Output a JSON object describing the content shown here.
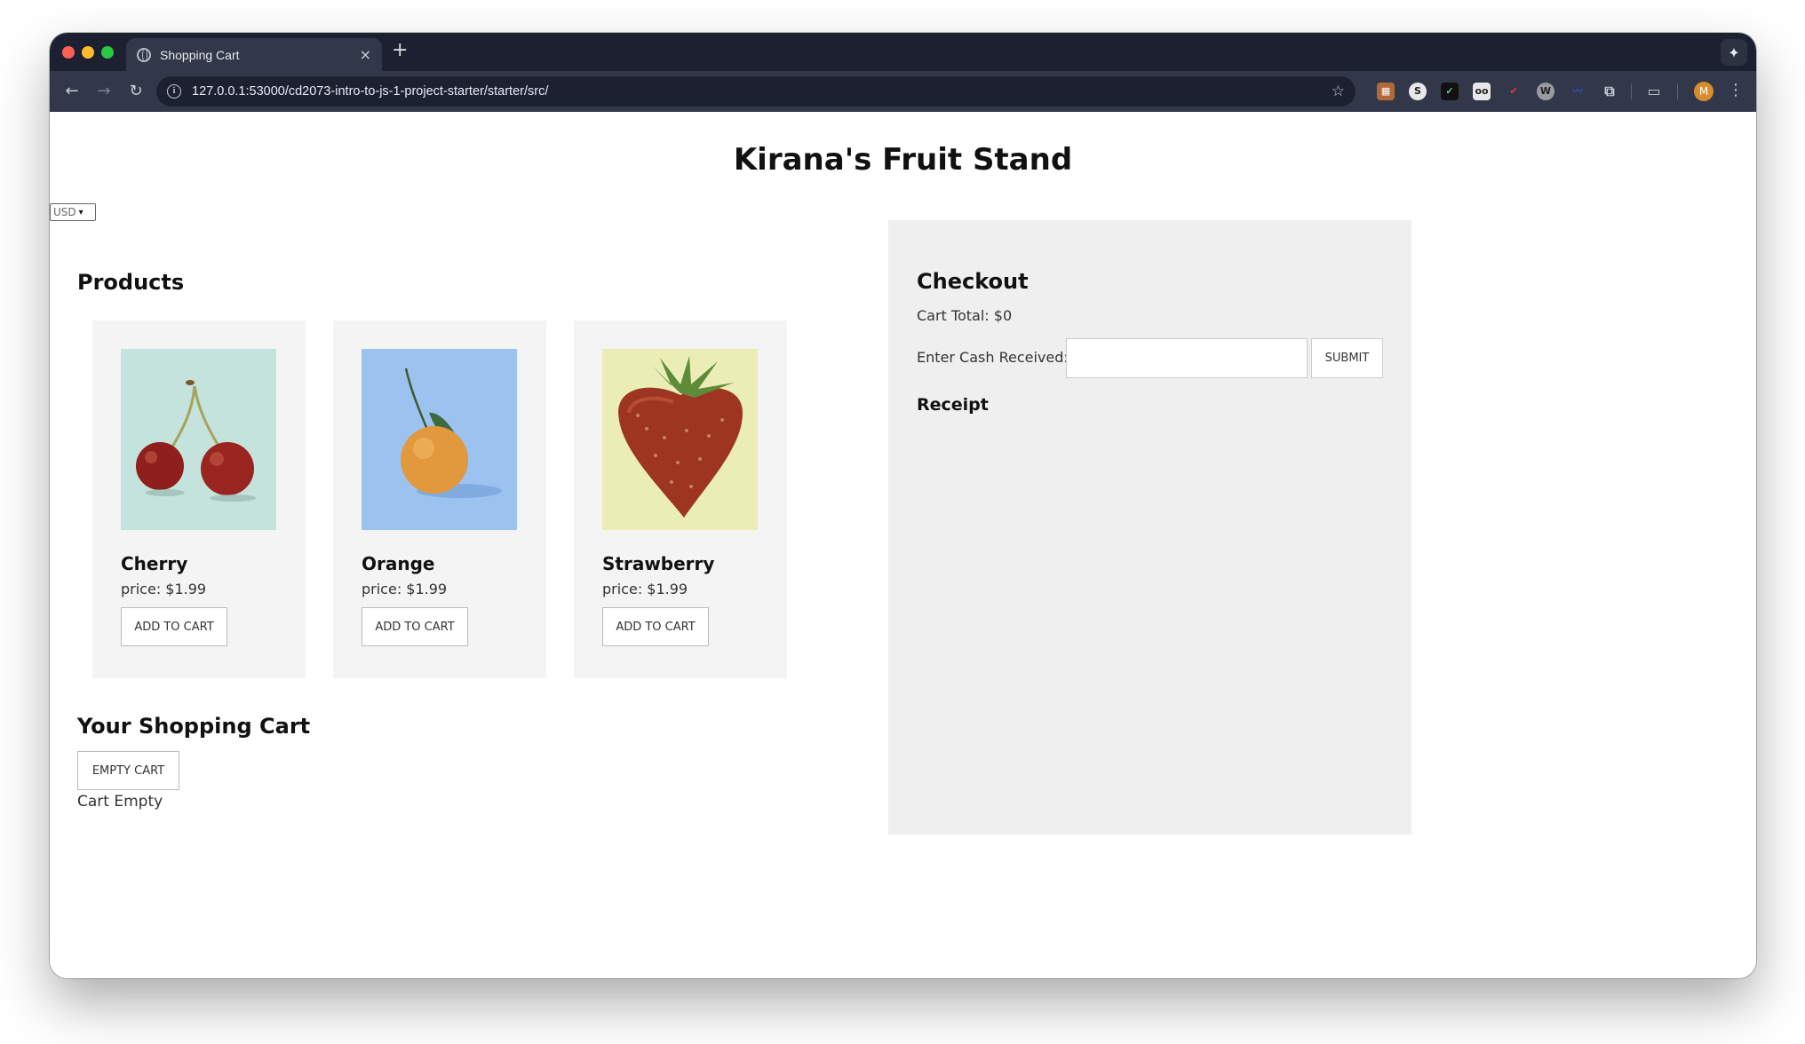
{
  "browser": {
    "tab_title": "Shopping Cart",
    "tab_close": "×",
    "new_tab": "+",
    "url": "127.0.0.1:53000/cd2073-intro-to-js-1-project-starter/starter/src/",
    "avatar_initial": "M"
  },
  "page": {
    "title": "Kirana's Fruit Stand",
    "currency": "USD"
  },
  "products": {
    "heading": "Products",
    "items": [
      {
        "name": "Cherry",
        "price": "price: $1.99",
        "button": "ADD TO CART",
        "image": "cherry-image",
        "bg_color": "#c3e3dc"
      },
      {
        "name": "Orange",
        "price": "price: $1.99",
        "button": "ADD TO CART",
        "image": "orange-image",
        "bg_color": "#9cc2ef"
      },
      {
        "name": "Strawberry",
        "price": "price: $1.99",
        "button": "ADD TO CART",
        "image": "strawberry-image",
        "bg_color": "#ebedb6"
      }
    ]
  },
  "cart": {
    "heading": "Your Shopping Cart",
    "empty_button": "EMPTY CART",
    "status": "Cart Empty"
  },
  "checkout": {
    "heading": "Checkout",
    "cart_total": "Cart Total: $0",
    "cash_label": "Enter Cash Received:",
    "cash_value": "",
    "submit": "SUBMIT",
    "receipt_heading": "Receipt"
  }
}
